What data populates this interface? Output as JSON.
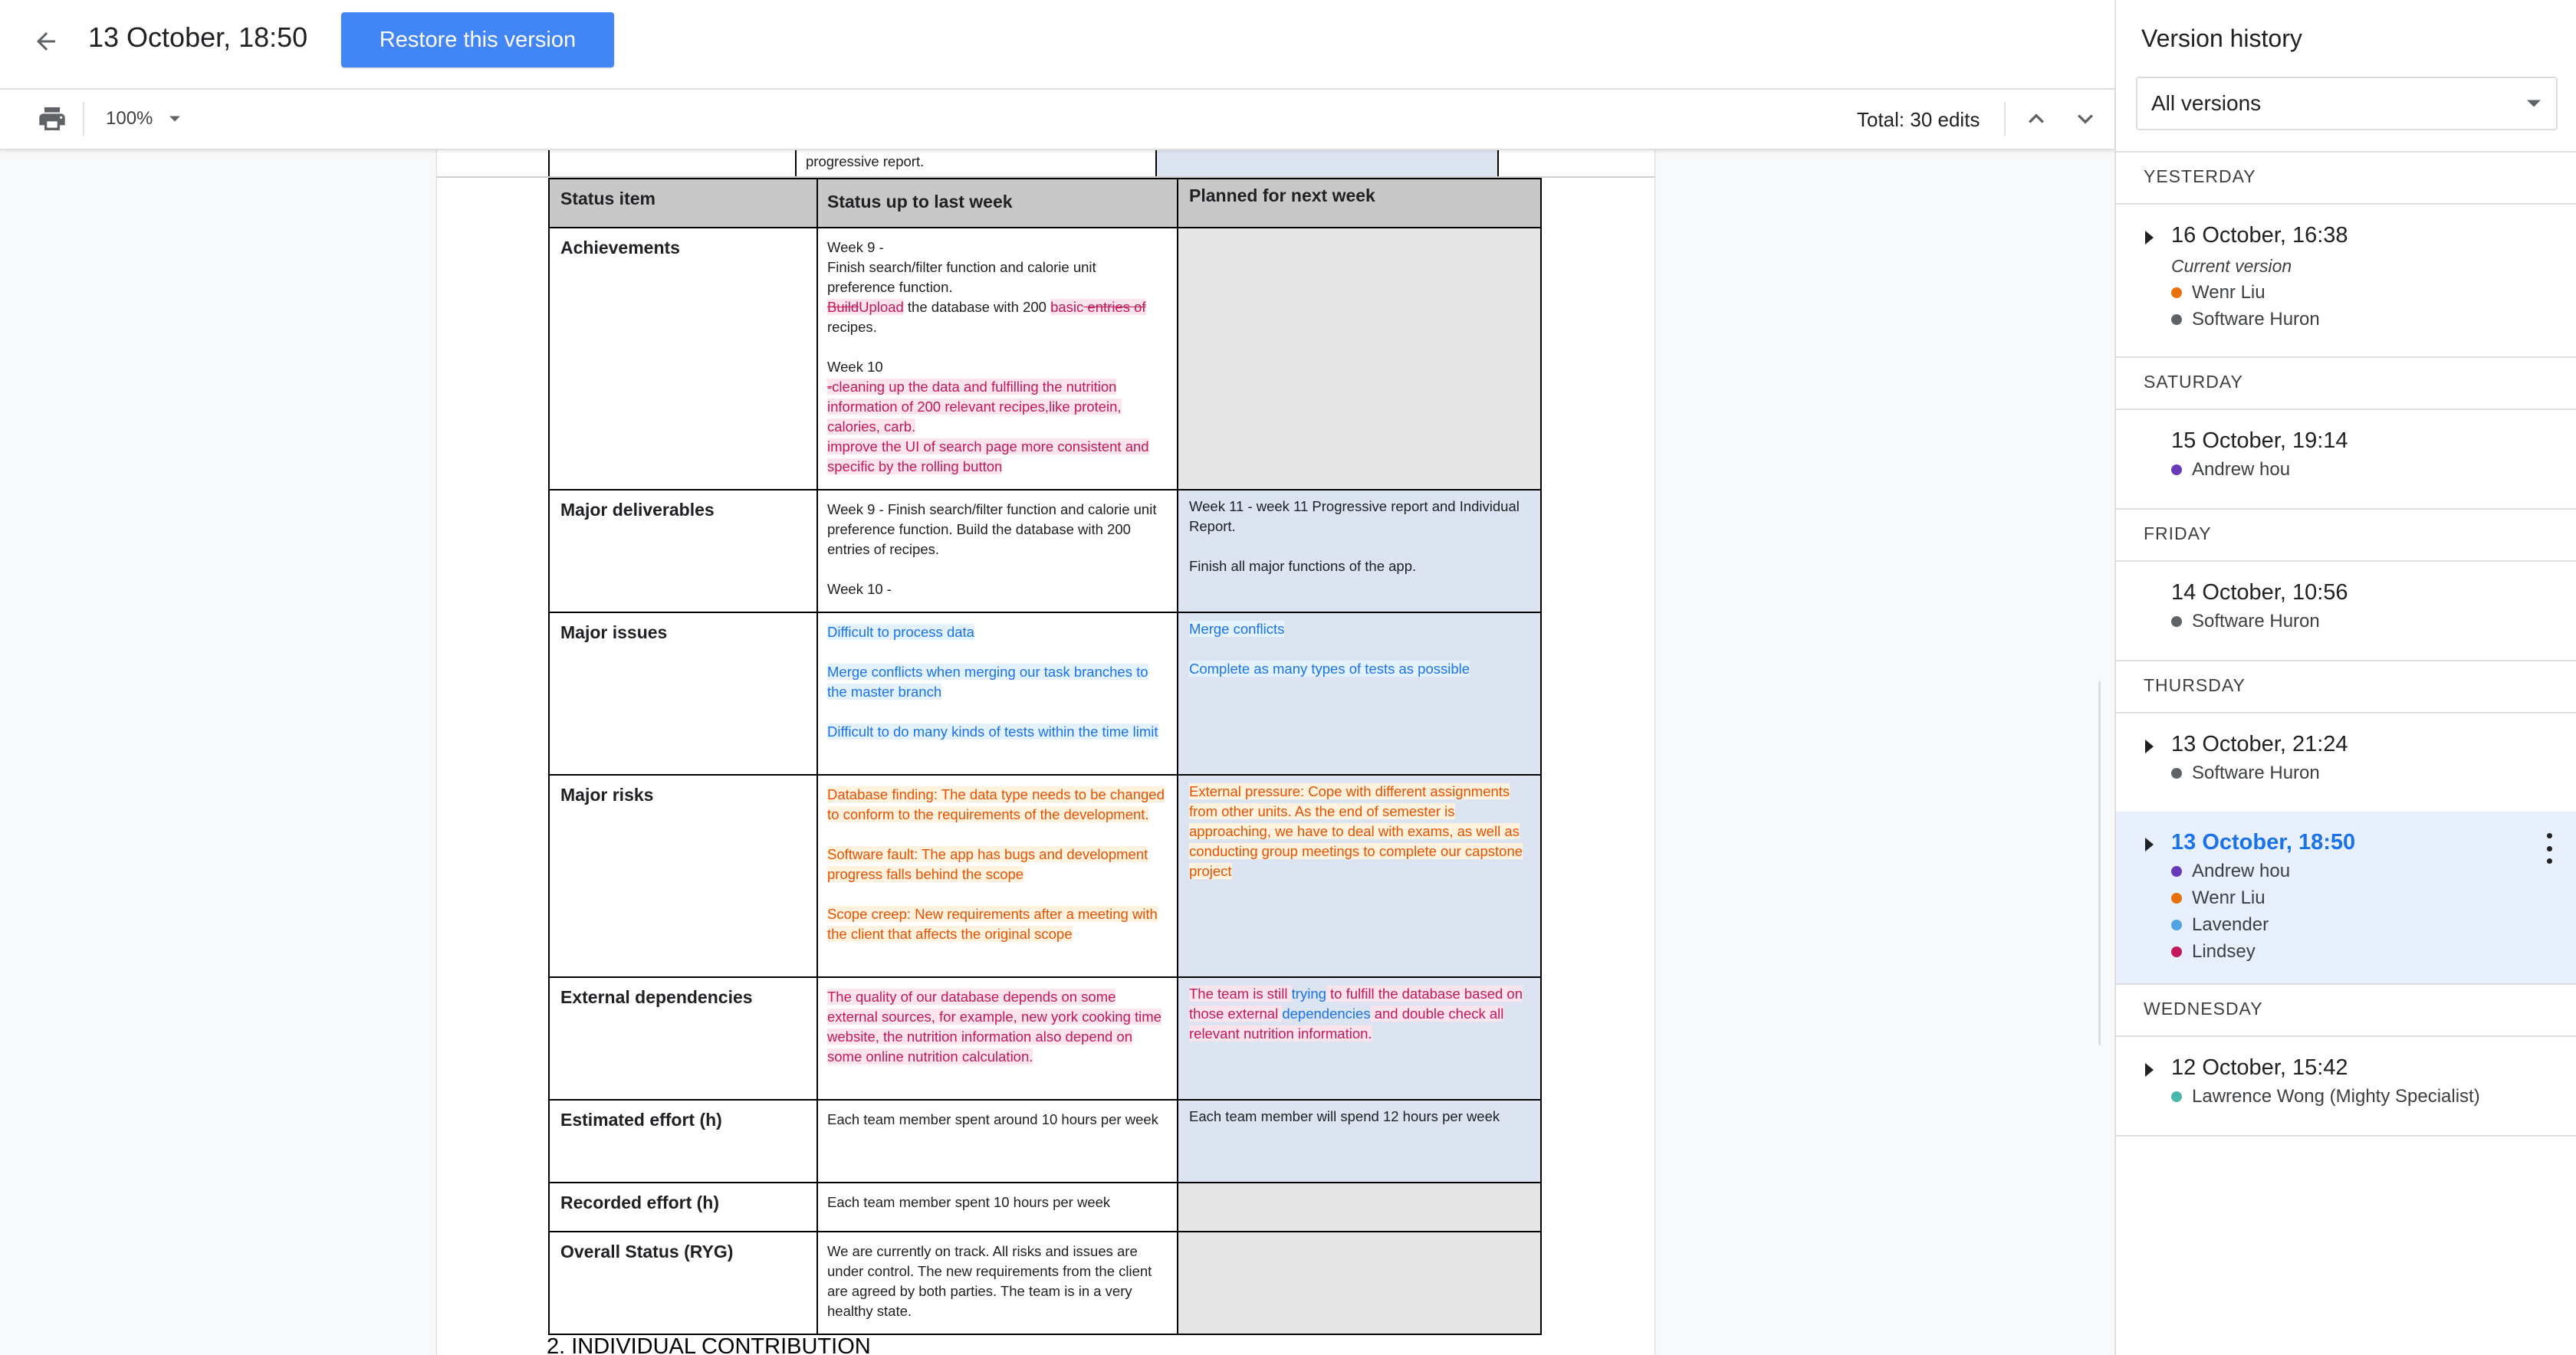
{
  "header": {
    "title": "13 October, 18:50",
    "restore_label": "Restore this version"
  },
  "toolbar": {
    "zoom": "100%",
    "total_edits": "Total: 30 edits"
  },
  "document": {
    "prev_row_text": "progressive report.",
    "columns": [
      "Status item",
      "Status up to last week",
      "Planned for next week"
    ],
    "rows": [
      {
        "item": "Achievements",
        "last_week": {
          "w9": "Week 9 -",
          "w9_line": "Finish search/filter function and calorie unit preference function.",
          "del_build": "Build",
          "ins_upload": "Upload",
          "db_text": " the database with 200 ",
          "ins_basic": "basic",
          "del_entries": " entries of",
          "recipes": " recipes.",
          "w10": "Week 10",
          "del_dash": "-",
          "w10_l1": "cleaning up the data and fulfilling the nutrition information of 200 relevant recipes,like protein, calories, carb.",
          "w10_l2": "improve the UI of search page more consistent and specific by the rolling button"
        },
        "next_week": ""
      },
      {
        "item": "Major deliverables",
        "last_week": {
          "l1": "Week 9 - Finish search/filter function and calorie unit preference function. Build the database with 200 entries of recipes.",
          "l2": "Week 10 -"
        },
        "next_week": {
          "l1": "Week 11 - week 11 Progressive report and Individual Report.",
          "l2": "Finish all major functions of the app."
        }
      },
      {
        "item": "Major issues",
        "last_week": {
          "l1": "Difficult to process data",
          "l2": "Merge conflicts when merging our task branches to the master branch",
          "l3": "Difficult to do many kinds of tests within the time limit"
        },
        "next_week": {
          "l1": "Merge conflicts",
          "l2": "Complete as many types of tests as possible"
        }
      },
      {
        "item": "Major risks",
        "last_week": {
          "l1": "Database finding: The data type needs to be changed to conform to the requirements of the development.",
          "l2": "Software fault: The app has bugs and development progress falls behind the scope",
          "l3": "Scope creep: New requirements after a meeting with the client that affects the original scope"
        },
        "next_week": {
          "l1": "External pressure: Cope with different assignments from other units. As the end of semester is approaching, we have to deal with exams, as well as conducting group meetings to complete our capstone project"
        }
      },
      {
        "item": "External dependencies",
        "last_week": {
          "l1": "The quality of our database depends on some external sources, for example, new york cooking time website, the nutrition information also depend on some online nutrition calculation."
        },
        "next_week": {
          "p1": "The team is still ",
          "p2": "trying",
          "p3": " to fulfill the database based on those external ",
          "p4": "dependencies",
          "p5": " and double check all relevant nutrition information."
        }
      },
      {
        "item": "Estimated effort (h)",
        "last_week": "Each team member spent around 10 hours per week",
        "next_week": "Each team member will spend 12 hours per week"
      },
      {
        "item": "Recorded effort (h)",
        "last_week": "Each team member spent 10 hours per week",
        "next_week": ""
      },
      {
        "item": "Overall Status (RYG)",
        "last_week": "We are currently on track. All risks and issues are under control. The new requirements from the client are agreed by both parties. The team is in a very healthy state.",
        "next_week": ""
      }
    ],
    "next_heading": "2. INDIVIDUAL CONTRIBUTION"
  },
  "sidebar": {
    "title": "Version history",
    "filter": "All versions",
    "groups": [
      {
        "day": "YESTERDAY",
        "entries": [
          {
            "time": "16 October, 16:38",
            "current": "Current version",
            "authors": [
              "Wenr Liu",
              "Software Huron"
            ]
          }
        ]
      },
      {
        "day": "SATURDAY",
        "entries": [
          {
            "time": "15 October, 19:14",
            "authors": [
              "Andrew hou"
            ]
          }
        ]
      },
      {
        "day": "FRIDAY",
        "entries": [
          {
            "time": "14 October, 10:56",
            "authors": [
              "Software Huron"
            ]
          }
        ]
      },
      {
        "day": "THURSDAY",
        "entries": [
          {
            "time": "13 October, 21:24",
            "authors": [
              "Software Huron"
            ]
          },
          {
            "time": "13 October, 18:50",
            "authors": [
              "Andrew hou",
              "Wenr Liu",
              "Lavender",
              "Lindsey"
            ]
          }
        ]
      },
      {
        "day": "WEDNESDAY",
        "entries": [
          {
            "time": "12 October, 15:42",
            "authors": [
              "Lawrence Wong (Mighty Specialist)"
            ]
          }
        ]
      }
    ],
    "colors": {
      "wenr_liu": "#e8710a",
      "software_huron": "#5f6368",
      "andrew_hou": "#673ab7",
      "lavender": "#4fa3e0",
      "lindsey": "#c2185b",
      "lawrence_wong": "#4db6ac"
    }
  }
}
